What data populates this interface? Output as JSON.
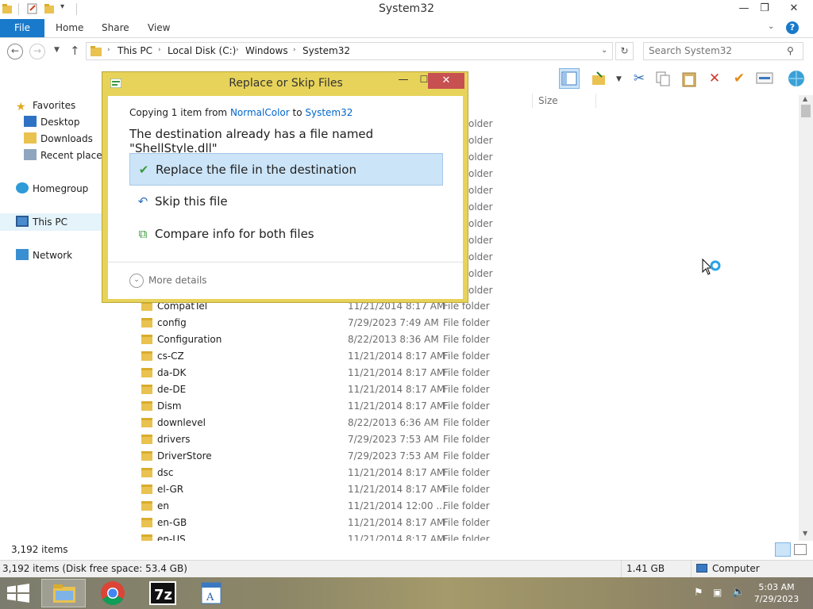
{
  "window": {
    "title": "System32"
  },
  "ribbon": {
    "tabs": [
      "File",
      "Home",
      "Share",
      "View"
    ]
  },
  "nav": {
    "breadcrumbs": [
      "This PC",
      "Local Disk (C:)",
      "Windows",
      "System32"
    ],
    "search_placeholder": "Search System32"
  },
  "navpane": {
    "favorites": "Favorites",
    "desktop": "Desktop",
    "downloads": "Downloads",
    "recent": "Recent places",
    "homegroup": "Homegroup",
    "thispc": "This PC",
    "network": "Network"
  },
  "list": {
    "size_header": "Size",
    "ghost_type": "older",
    "rows": [
      {
        "name": "CompatTel",
        "date": "11/21/2014 8:17 AM",
        "type": "File folder"
      },
      {
        "name": "config",
        "date": "7/29/2023 7:49 AM",
        "type": "File folder"
      },
      {
        "name": "Configuration",
        "date": "8/22/2013 8:36 AM",
        "type": "File folder"
      },
      {
        "name": "cs-CZ",
        "date": "11/21/2014 8:17 AM",
        "type": "File folder"
      },
      {
        "name": "da-DK",
        "date": "11/21/2014 8:17 AM",
        "type": "File folder"
      },
      {
        "name": "de-DE",
        "date": "11/21/2014 8:17 AM",
        "type": "File folder"
      },
      {
        "name": "Dism",
        "date": "11/21/2014 8:17 AM",
        "type": "File folder"
      },
      {
        "name": "downlevel",
        "date": "8/22/2013 6:36 AM",
        "type": "File folder"
      },
      {
        "name": "drivers",
        "date": "7/29/2023 7:53 AM",
        "type": "File folder"
      },
      {
        "name": "DriverStore",
        "date": "7/29/2023 7:53 AM",
        "type": "File folder"
      },
      {
        "name": "dsc",
        "date": "11/21/2014 8:17 AM",
        "type": "File folder"
      },
      {
        "name": "el-GR",
        "date": "11/21/2014 8:17 AM",
        "type": "File folder"
      },
      {
        "name": "en",
        "date": "11/21/2014 12:00 ...",
        "type": "File folder"
      },
      {
        "name": "en-GB",
        "date": "11/21/2014 8:17 AM",
        "type": "File folder"
      },
      {
        "name": "en-US",
        "date": "11/21/2014 8:17 AM",
        "type": "File folder"
      }
    ]
  },
  "status": {
    "item_count": "3,192 items",
    "bar_left": "3,192 items (Disk free space: 53.4 GB)",
    "bar_size": "1.41 GB",
    "bar_location": "Computer"
  },
  "dialog": {
    "title": "Replace or Skip Files",
    "copying_prefix": "Copying 1 item from ",
    "from": "NormalColor",
    "to_word": " to ",
    "to": "System32",
    "heading": "The destination already has a file named \"ShellStyle.dll\"",
    "options": [
      "Replace the file in the destination",
      "Skip this file",
      "Compare info for both files"
    ],
    "more_details": "More details"
  },
  "taskbar": {
    "time": "5:03 AM",
    "date": "7/29/2023"
  },
  "colors": {
    "accent": "#1979ca",
    "dialog_frame": "#e7d35a",
    "close_red": "#c75050",
    "selection": "#cce4f7"
  }
}
